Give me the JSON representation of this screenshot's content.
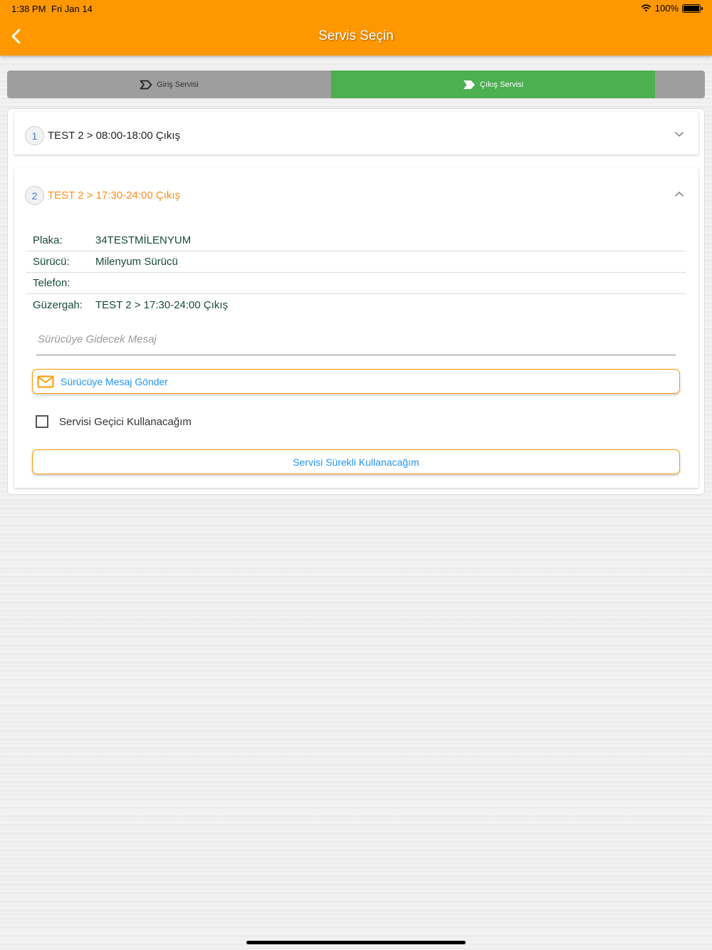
{
  "status_bar": {
    "time": "1:38 PM",
    "date": "Fri Jan 14",
    "battery": "100%"
  },
  "header": {
    "title": "Servis Seçin",
    "back_icon": "chevron-left-icon"
  },
  "tabs": [
    {
      "label": "Giriş Servisi",
      "icon": "enter-arrow-icon",
      "active": false
    },
    {
      "label": "Çıkış Servisi",
      "icon": "exit-arrow-icon",
      "active": true
    }
  ],
  "services": [
    {
      "number": "1",
      "title": "TEST 2 > 08:00-18:00 Çıkış",
      "expanded": false
    },
    {
      "number": "2",
      "title": "TEST 2 > 17:30-24:00 Çıkış",
      "expanded": true,
      "details": [
        {
          "label": "Plaka:",
          "value": "34TESTMİLENYUM"
        },
        {
          "label": "Sürücü:",
          "value": "Milenyum Sürücü"
        },
        {
          "label": "Telefon:",
          "value": ""
        },
        {
          "label": "Güzergah:",
          "value": "TEST 2 > 17:30-24:00 Çıkış"
        }
      ],
      "message_placeholder": "Sürücüye Gidecek Mesaj",
      "send_button": "Sürücüye Mesaj Gönder",
      "temporary_checkbox": {
        "label": "Servisi Geçici Kullanacağım",
        "checked": false
      },
      "permanent_button": "Servisi Sürekli Kullanacağım"
    }
  ],
  "colors": {
    "header": "#ff9800",
    "active_tab": "#4caf50",
    "accent_text": "#2196f3"
  }
}
